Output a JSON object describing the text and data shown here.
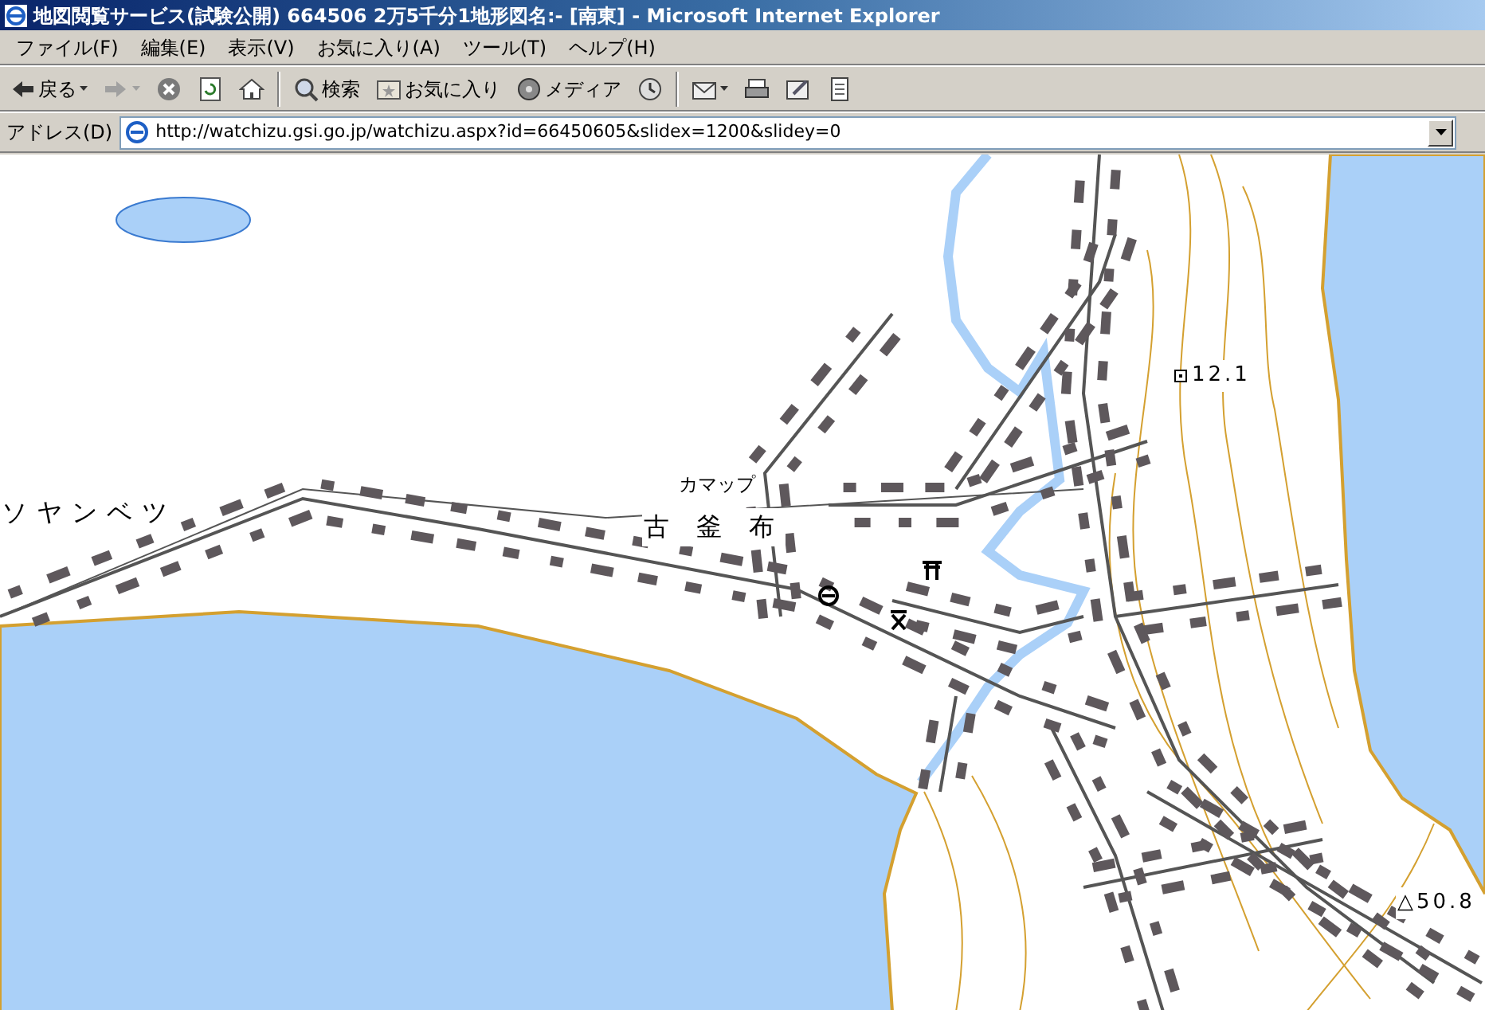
{
  "window": {
    "title": "地図閲覧サービス(試験公開) 664506 2万5千分1地形図名:- [南東] - Microsoft Internet Explorer"
  },
  "menu": [
    "ファイル(F)",
    "編集(E)",
    "表示(V)",
    "お気に入り(A)",
    "ツール(T)",
    "ヘルプ(H)"
  ],
  "toolbar": [
    {
      "kind": "back",
      "label": "戻る",
      "disabled": false
    },
    {
      "kind": "forward",
      "disabled": true
    },
    {
      "kind": "stop"
    },
    {
      "kind": "refresh"
    },
    {
      "kind": "home"
    },
    {
      "kind": "separator"
    },
    {
      "kind": "search",
      "label": "検索"
    },
    {
      "kind": "favorites",
      "label": "お気に入り"
    },
    {
      "kind": "media",
      "label": "メディア"
    },
    {
      "kind": "history"
    },
    {
      "kind": "separator"
    },
    {
      "kind": "mail"
    },
    {
      "kind": "print"
    },
    {
      "kind": "edit"
    },
    {
      "kind": "discuss"
    }
  ],
  "address": {
    "label": "アドレス(D)",
    "value": "http://watchizu.gsi.go.jp/watchizu.aspx?id=66450605&slidex=1200&slidey=0"
  },
  "map": {
    "labels": [
      {
        "kind": "place",
        "text": "ソヤンベツ"
      },
      {
        "kind": "small",
        "text": "カマップ"
      },
      {
        "kind": "place",
        "text": "古 釜 布"
      },
      {
        "kind": "benchmark",
        "text": "12.1"
      },
      {
        "kind": "triangulation",
        "text": "△50.8"
      }
    ],
    "symbols": [
      {
        "kind": "post"
      },
      {
        "kind": "shrine"
      },
      {
        "kind": "school"
      }
    ]
  }
}
